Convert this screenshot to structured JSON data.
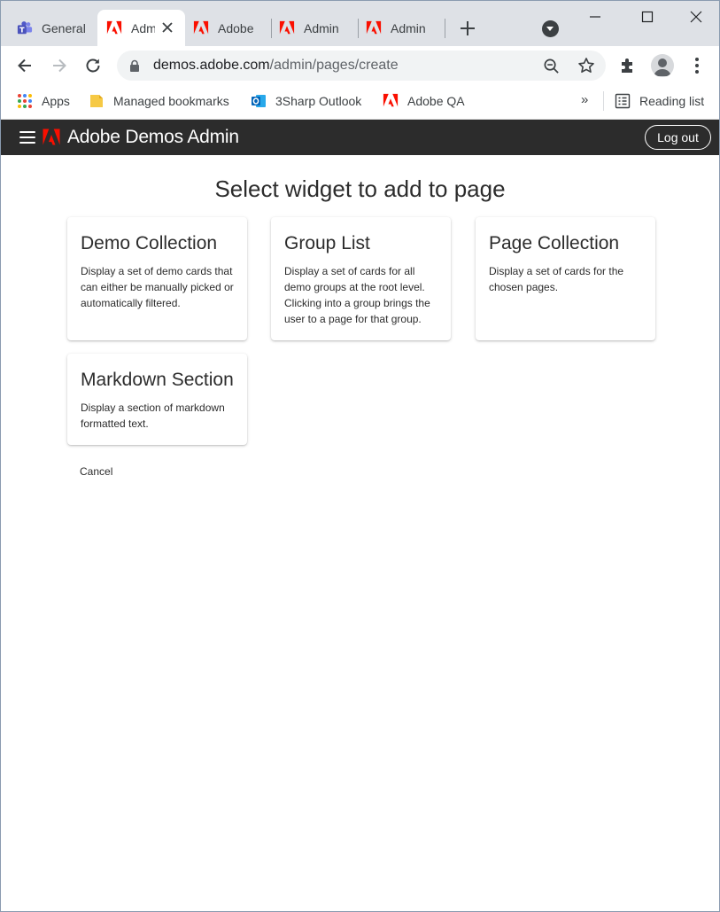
{
  "browser": {
    "tabs": [
      {
        "label": "General",
        "icon": "teams-icon",
        "active": false
      },
      {
        "label": "Admin",
        "icon": "adobe-icon",
        "active": true
      },
      {
        "label": "Adobe",
        "icon": "adobe-icon",
        "active": false
      },
      {
        "label": "Admin",
        "icon": "adobe-icon",
        "active": false
      },
      {
        "label": "Admin",
        "icon": "adobe-icon",
        "active": false
      }
    ],
    "address": {
      "host": "demos.adobe.com",
      "path": "/admin/pages/create"
    },
    "bookmarks": [
      {
        "label": "Apps",
        "icon": "apps-grid-icon"
      },
      {
        "label": "Managed bookmarks",
        "icon": "folder-icon"
      },
      {
        "label": "3Sharp Outlook",
        "icon": "outlook-icon"
      },
      {
        "label": "Adobe QA",
        "icon": "adobe-icon"
      }
    ],
    "overflow_label": "»",
    "reading_list_label": "Reading list"
  },
  "app": {
    "title": "Adobe Demos Admin",
    "logout_label": "Log out"
  },
  "main": {
    "heading": "Select widget to add to page",
    "widgets": [
      {
        "title": "Demo Collection",
        "description": "Display a set of demo cards that can either be manually picked or automatically filtered."
      },
      {
        "title": "Group List",
        "description": "Display a set of cards for all demo groups at the root level. Clicking into a group brings the user to a page for that group."
      },
      {
        "title": "Page Collection",
        "description": "Display a set of cards for the chosen pages."
      },
      {
        "title": "Markdown Section",
        "description": "Display a section of markdown formatted text."
      }
    ],
    "cancel_label": "Cancel"
  },
  "colors": {
    "adobe_red": "#fa0f00",
    "app_header": "#2c2c2c",
    "tab_strip": "#dee1e6"
  }
}
